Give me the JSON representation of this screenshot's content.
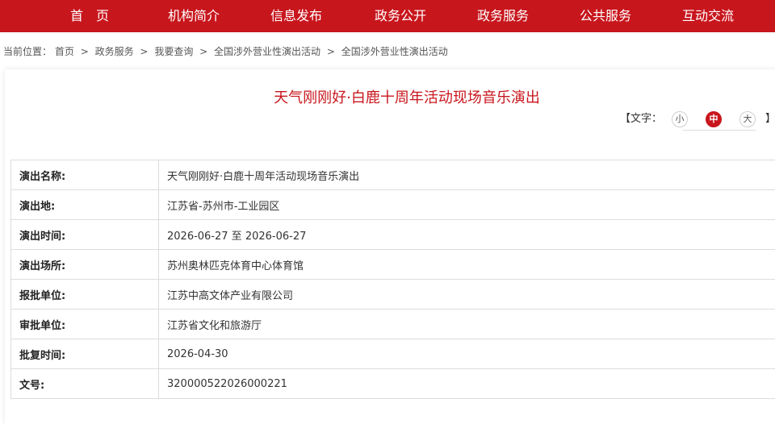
{
  "nav": {
    "items": [
      "首　页",
      "机构简介",
      "信息发布",
      "政务公开",
      "政务服务",
      "公共服务",
      "互动交流"
    ]
  },
  "breadcrumb": {
    "prefix": "当前位置：",
    "items": [
      "首页",
      "政务服务",
      "我要查询",
      "全国涉外营业性演出活动",
      "全国涉外营业性演出活动"
    ],
    "separator": ">"
  },
  "article": {
    "title": "天气刚刚好·白鹿十周年活动现场音乐演出"
  },
  "font_size": {
    "label": "【文字：",
    "small": "小",
    "medium": "中",
    "large": "大",
    "close": "】",
    "selected": "中"
  },
  "info_table": [
    {
      "label": "演出名称:",
      "value": "天气刚刚好·白鹿十周年活动现场音乐演出"
    },
    {
      "label": "演出地:",
      "value": "江苏省-苏州市-工业园区"
    },
    {
      "label": "演出时间:",
      "value": "2026-06-27 至 2026-06-27"
    },
    {
      "label": "演出场所:",
      "value": "苏州奥林匹克体育中心体育馆"
    },
    {
      "label": "报批单位:",
      "value": "江苏中高文体产业有限公司"
    },
    {
      "label": "审批单位:",
      "value": "江苏省文化和旅游厅"
    },
    {
      "label": "批复时间:",
      "value": "2026-04-30"
    },
    {
      "label": "文号:",
      "value": "320000522026000221"
    }
  ],
  "colors": {
    "brand_red": "#c8161d",
    "border": "#dddddd"
  }
}
